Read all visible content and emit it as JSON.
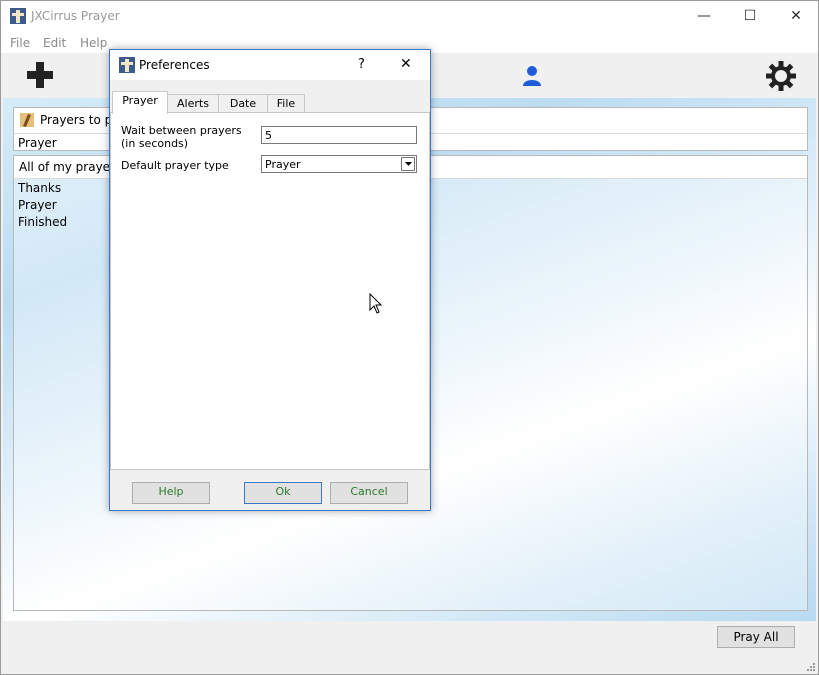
{
  "app": {
    "title": "JXCirrus Prayer",
    "controls": {
      "minimize": "—",
      "maximize": "☐",
      "close": "✕"
    }
  },
  "menu": {
    "file": "File",
    "edit": "Edit",
    "help": "Help"
  },
  "toolbar": {
    "add_icon": "plus-icon",
    "person_icon": "person-icon",
    "settings_icon": "gear-icon"
  },
  "prayers_to_pray": {
    "heading": "Prayers to pra",
    "type_label": "Prayer"
  },
  "list": {
    "heading": "All of my prayers.",
    "items": [
      "Thanks",
      "Prayer",
      "Finished"
    ]
  },
  "footer": {
    "pray_all": "Pray All"
  },
  "dialog": {
    "title": "Preferences",
    "help_glyph": "?",
    "close_glyph": "✕",
    "tabs": [
      "Prayer",
      "Alerts",
      "Date",
      "File"
    ],
    "wait_label_line1": "Wait between prayers",
    "wait_label_line2": "(in seconds)",
    "wait_value": "5",
    "type_label": "Default prayer type",
    "type_value": "Prayer",
    "buttons": {
      "help": "Help",
      "ok": "Ok",
      "cancel": "Cancel"
    }
  },
  "colors": {
    "accent": "#3b79c4",
    "button_text": "#2b7a2b",
    "person": "#1e5bd8"
  }
}
